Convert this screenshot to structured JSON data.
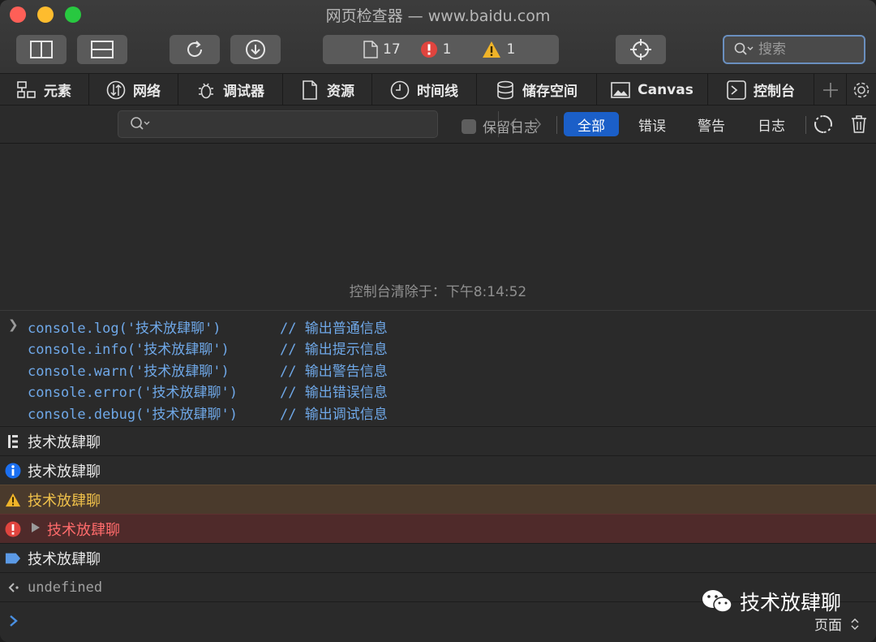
{
  "window": {
    "title": "网页检查器 — www.baidu.com"
  },
  "toolbar": {
    "resource_count": "17",
    "error_count": "1",
    "warning_count": "1",
    "search_placeholder": "搜索"
  },
  "tabs": [
    {
      "label": "元素",
      "icon": "elements-icon"
    },
    {
      "label": "网络",
      "icon": "network-icon"
    },
    {
      "label": "调试器",
      "icon": "debugger-bug-icon"
    },
    {
      "label": "资源",
      "icon": "resources-doc-icon"
    },
    {
      "label": "时间线",
      "icon": "timeline-clock-icon"
    },
    {
      "label": "储存空间",
      "icon": "storage-database-icon"
    },
    {
      "label": "Canvas",
      "icon": "canvas-image-icon"
    },
    {
      "label": "控制台",
      "icon": "console-icon"
    }
  ],
  "filter": {
    "search_value": "",
    "preserve_log_label": "保留日志",
    "levels": [
      "全部",
      "错误",
      "警告",
      "日志"
    ],
    "active_level": "全部"
  },
  "console": {
    "cleared_text": "控制台清除于：下午8:14:52",
    "code_lines": [
      {
        "code": "console.log('技术放肆聊')",
        "comment": "// 输出普通信息"
      },
      {
        "code": "console.info('技术放肆聊')",
        "comment": "// 输出提示信息"
      },
      {
        "code": "console.warn('技术放肆聊')",
        "comment": "// 输出警告信息"
      },
      {
        "code": "console.error('技术放肆聊')",
        "comment": "// 输出错误信息"
      },
      {
        "code": "console.debug('技术放肆聊')",
        "comment": "// 输出调试信息"
      }
    ],
    "messages": {
      "log": "技术放肆聊",
      "info": "技术放肆聊",
      "warn": "技术放肆聊",
      "error": "技术放肆聊",
      "debug": "技术放肆聊"
    },
    "result": "undefined",
    "prompt_value": ""
  },
  "watermark": {
    "text": "技术放肆聊"
  },
  "context_selector": {
    "label": "页面"
  },
  "colors": {
    "accent": "#1b5fc8",
    "code": "#6fa8e8",
    "warning_bg": "#4a3a2c",
    "warning_text": "#f0c14a",
    "error_bg": "#4f2a2a",
    "error_text": "#ff6b6b"
  }
}
